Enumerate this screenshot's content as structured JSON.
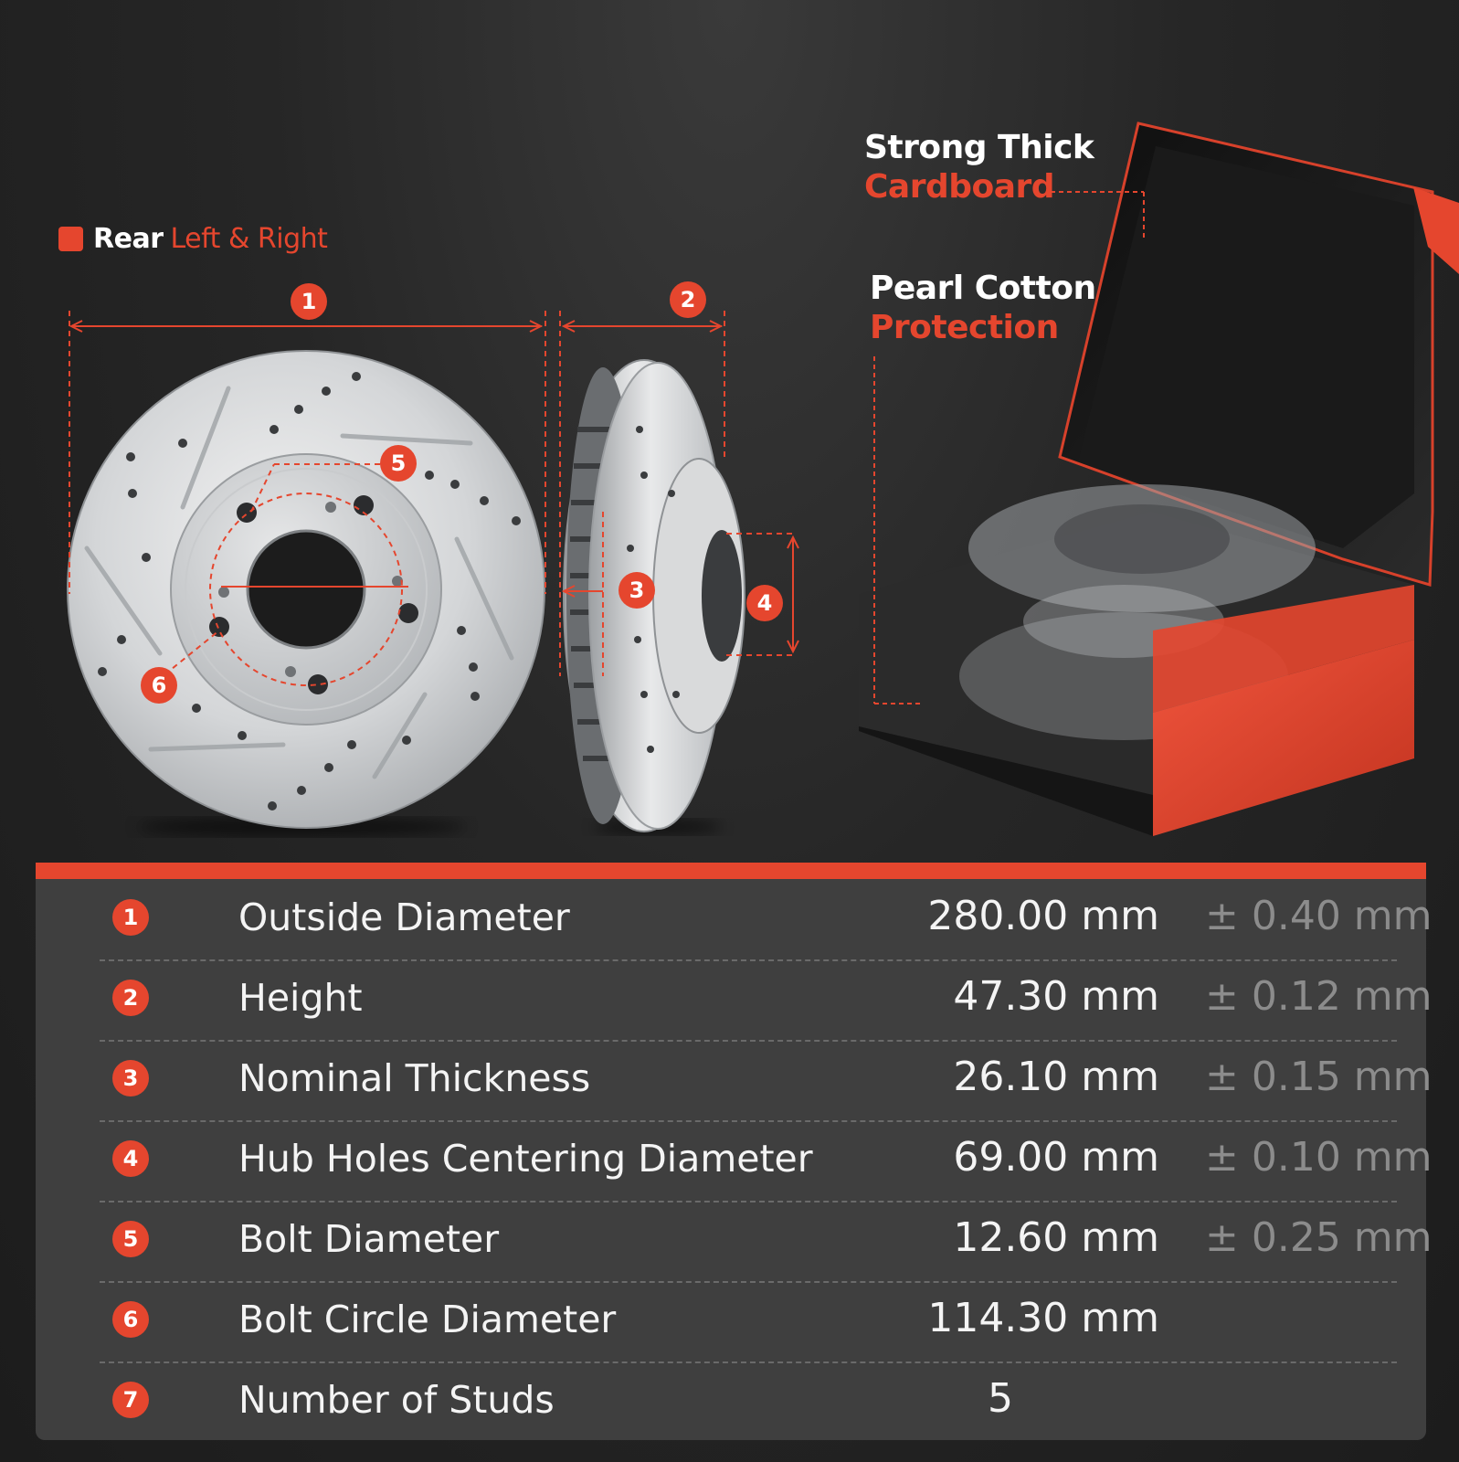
{
  "colors": {
    "accent": "#e5462e",
    "panel": "#3f3f3f",
    "background": "#242424",
    "text": "#ffffff",
    "tolerance": "#8c8c8c"
  },
  "header": {
    "rear": "Rear",
    "sides": "Left & Right"
  },
  "packaging": {
    "cardboard_line1": "Strong Thick",
    "cardboard_line2": "Cardboard",
    "pearl_line1": "Pearl Cotton",
    "pearl_line2": "Protection"
  },
  "callouts": [
    "1",
    "2",
    "3",
    "4",
    "5",
    "6"
  ],
  "specs": [
    {
      "num": "1",
      "name": "Outside Diameter",
      "value": "280.00 mm",
      "tolerance": "± 0.40 mm"
    },
    {
      "num": "2",
      "name": "Height",
      "value": "47.30 mm",
      "tolerance": "± 0.12 mm"
    },
    {
      "num": "3",
      "name": "Nominal Thickness",
      "value": "26.10 mm",
      "tolerance": "± 0.15 mm"
    },
    {
      "num": "4",
      "name": "Hub Holes Centering Diameter",
      "value": "69.00 mm",
      "tolerance": "± 0.10 mm"
    },
    {
      "num": "5",
      "name": "Bolt Diameter",
      "value": "12.60 mm",
      "tolerance": "± 0.25 mm"
    },
    {
      "num": "6",
      "name": "Bolt Circle Diameter",
      "value": "114.30 mm",
      "tolerance": ""
    },
    {
      "num": "7",
      "name": "Number of Studs",
      "value": "5",
      "tolerance": ""
    }
  ]
}
